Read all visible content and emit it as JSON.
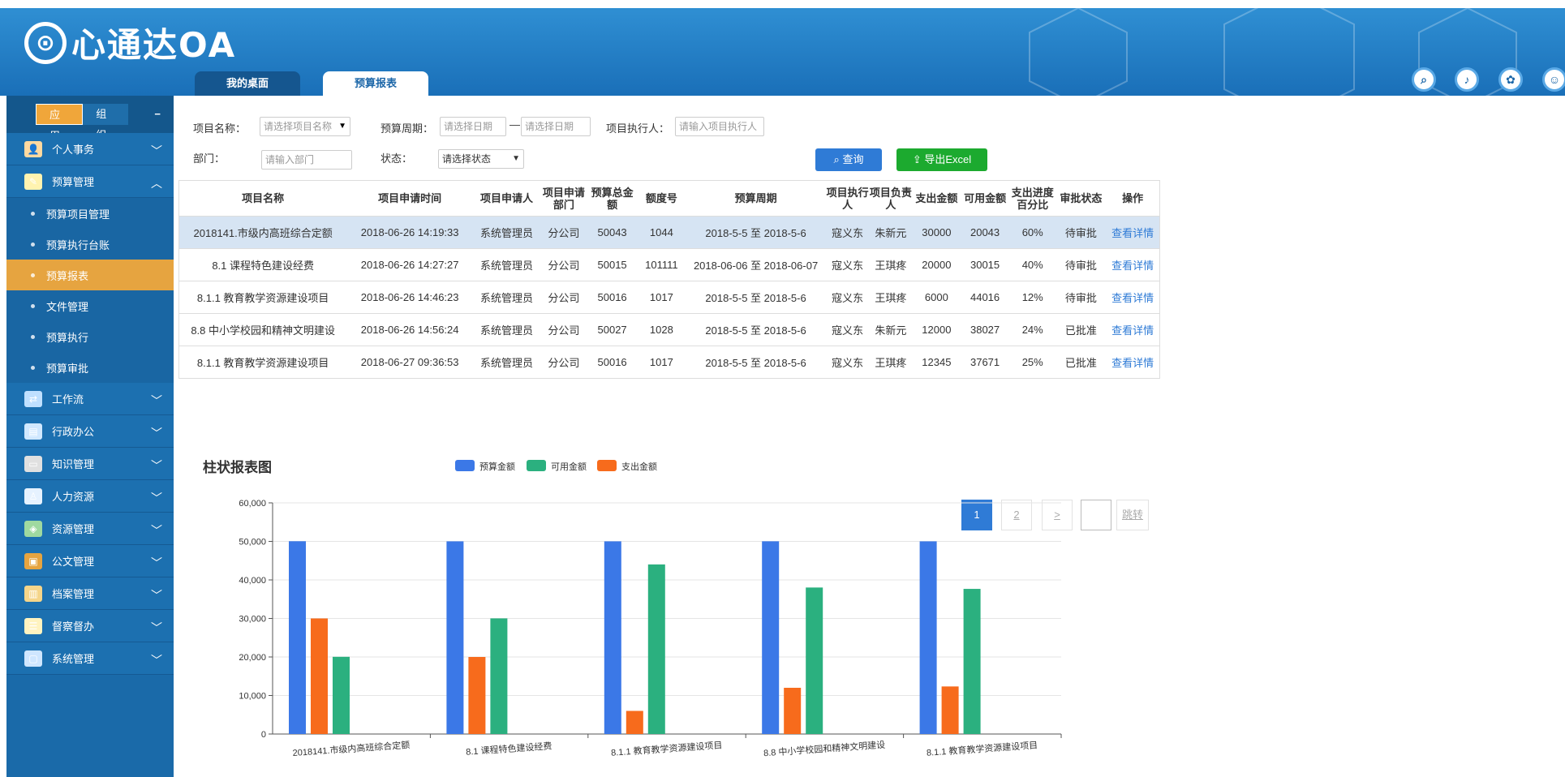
{
  "header": {
    "logo_text": "心通达OA",
    "tabs": [
      {
        "label": "我的桌面"
      },
      {
        "label": "预算报表"
      }
    ],
    "icons": [
      "search-icon",
      "bell-icon",
      "palette-icon",
      "user-icon"
    ]
  },
  "sidebar": {
    "switch": {
      "app": "应用",
      "org": "组织",
      "collapse": "−"
    },
    "groups": [
      {
        "label": "个人事务"
      },
      {
        "label": "预算管理"
      },
      {
        "label": "工作流"
      },
      {
        "label": "行政办公"
      },
      {
        "label": "知识管理"
      },
      {
        "label": "人力资源"
      },
      {
        "label": "资源管理"
      },
      {
        "label": "公文管理"
      },
      {
        "label": "档案管理"
      },
      {
        "label": "督察督办"
      },
      {
        "label": "系统管理"
      }
    ],
    "subitems": [
      {
        "label": "预算项目管理"
      },
      {
        "label": "预算执行台账"
      },
      {
        "label": "预算报表"
      },
      {
        "label": "文件管理"
      },
      {
        "label": "预算执行"
      },
      {
        "label": "预算审批"
      }
    ]
  },
  "filters": {
    "project_name_label": "项目名称：",
    "project_name_placeholder": "请选择项目名称",
    "period_label": "预算周期：",
    "period_start_placeholder": "请选择日期",
    "period_sep": "—",
    "period_end_placeholder": "请选择日期",
    "executor_label": "项目执行人：",
    "executor_placeholder": "请输入项目执行人",
    "dept_label": "部门：",
    "dept_placeholder": "请输入部门",
    "status_label": "状态：",
    "status_value": "请选择状态",
    "query_button": "查询",
    "export_button": "导出Excel"
  },
  "table": {
    "headers": [
      "项目名称",
      "项目申请时间",
      "项目申请人",
      "项目申请部门",
      "预算总金额",
      "额度号",
      "预算周期",
      "项目执行人",
      "项目负责人",
      "支出金额",
      "可用金额",
      "支出进度百分比",
      "审批状态",
      "操作"
    ],
    "rows": [
      [
        "2018141.市级内高班综合定额",
        "2018-06-26 14:19:33",
        "系统管理员",
        "分公司",
        "50043",
        "1044",
        "2018-5-5 至 2018-5-6",
        "寇义东",
        "朱新元",
        "30000",
        "20043",
        "60%",
        "待审批",
        "查看详情"
      ],
      [
        "8.1 课程特色建设经费",
        "2018-06-26 14:27:27",
        "系统管理员",
        "分公司",
        "50015",
        "101111",
        "2018-06-06 至 2018-06-07",
        "寇义东",
        "王琪疼",
        "20000",
        "30015",
        "40%",
        "待审批",
        "查看详情"
      ],
      [
        "8.1.1 教育教学资源建设项目",
        "2018-06-26 14:46:23",
        "系统管理员",
        "分公司",
        "50016",
        "1017",
        "2018-5-5 至 2018-5-6",
        "寇义东",
        "王琪疼",
        "6000",
        "44016",
        "12%",
        "待审批",
        "查看详情"
      ],
      [
        "8.8 中小学校园和精神文明建设",
        "2018-06-26 14:56:24",
        "系统管理员",
        "分公司",
        "50027",
        "1028",
        "2018-5-5 至 2018-5-6",
        "寇义东",
        "朱新元",
        "12000",
        "38027",
        "24%",
        "已批准",
        "查看详情"
      ],
      [
        "8.1.1 教育教学资源建设项目",
        "2018-06-27 09:36:53",
        "系统管理员",
        "分公司",
        "50016",
        "1017",
        "2018-5-5 至 2018-5-6",
        "寇义东",
        "王琪疼",
        "12345",
        "37671",
        "25%",
        "已批准",
        "查看详情"
      ]
    ]
  },
  "pager": {
    "pages": [
      "1",
      "2"
    ],
    "next": ">",
    "jump": "跳转",
    "current": "1"
  },
  "chart_data": {
    "type": "bar",
    "title": "柱状报表图",
    "categories": [
      "2018141.市级内高班综合定额",
      "8.1 课程特色建设经费",
      "8.1.1 教育教学资源建设项目",
      "8.8 中小学校园和精神文明建设",
      "8.1.1 教育教学资源建设项目"
    ],
    "series": [
      {
        "name": "预算金额",
        "color": "#3b78e7",
        "values": [
          50043,
          50015,
          50016,
          50027,
          50016
        ]
      },
      {
        "name": "支出金额",
        "color": "#f76b1c",
        "values": [
          30000,
          20000,
          6000,
          12000,
          12345
        ]
      },
      {
        "name": "可用金额",
        "color": "#2bb07f",
        "values": [
          20043,
          30015,
          44016,
          38027,
          37671
        ]
      }
    ],
    "legend_order": [
      "预算金额",
      "可用金额",
      "支出金额"
    ],
    "ylim": [
      0,
      60000
    ],
    "yticks": [
      "0",
      "10,000",
      "20,000",
      "30,000",
      "40,000",
      "50,000",
      "60,000"
    ],
    "legend_position": "top",
    "grid": true
  }
}
